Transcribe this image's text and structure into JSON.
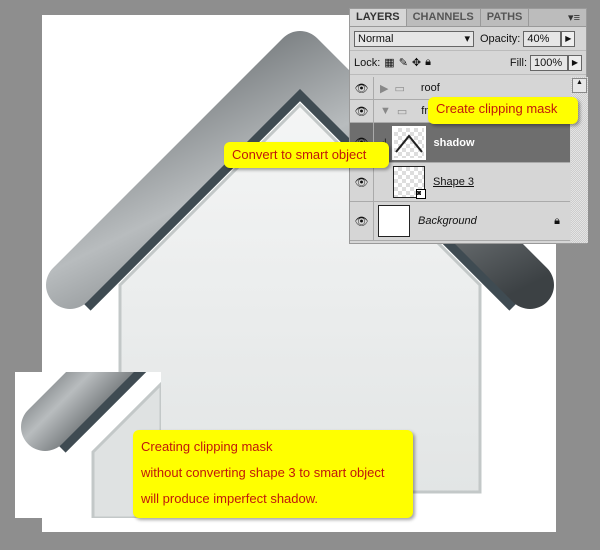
{
  "panel": {
    "tabs": [
      {
        "label": "LAYERS",
        "active": true
      },
      {
        "label": "CHANNELS"
      },
      {
        "label": "PATHS"
      }
    ],
    "menu_icon": "panel-menu-icon",
    "blend_mode": "Normal",
    "opacity_label": "Opacity:",
    "opacity_value": "40%",
    "lock_label": "Lock:",
    "fill_label": "Fill:",
    "fill_value": "100%",
    "layers": [
      {
        "name": "roof",
        "type": "group",
        "expanded": false
      },
      {
        "name": "fr",
        "type": "group",
        "expanded": true
      },
      {
        "name": "shadow",
        "type": "layer",
        "selected": true,
        "clipped": true
      },
      {
        "name": "Shape 3",
        "type": "smart-object"
      },
      {
        "name": "Background",
        "type": "background",
        "locked": true
      }
    ]
  },
  "callouts": {
    "clipping": "Create clipping mask",
    "smart": "Convert to smart object",
    "inset_lines": [
      "Creating clipping mask",
      "without converting shape 3 to smart object",
      "will produce imperfect shadow."
    ]
  },
  "colors": {
    "callout_bg": "#ffff00",
    "callout_text": "#c0180c",
    "selected_layer": "#6e6e6e"
  }
}
